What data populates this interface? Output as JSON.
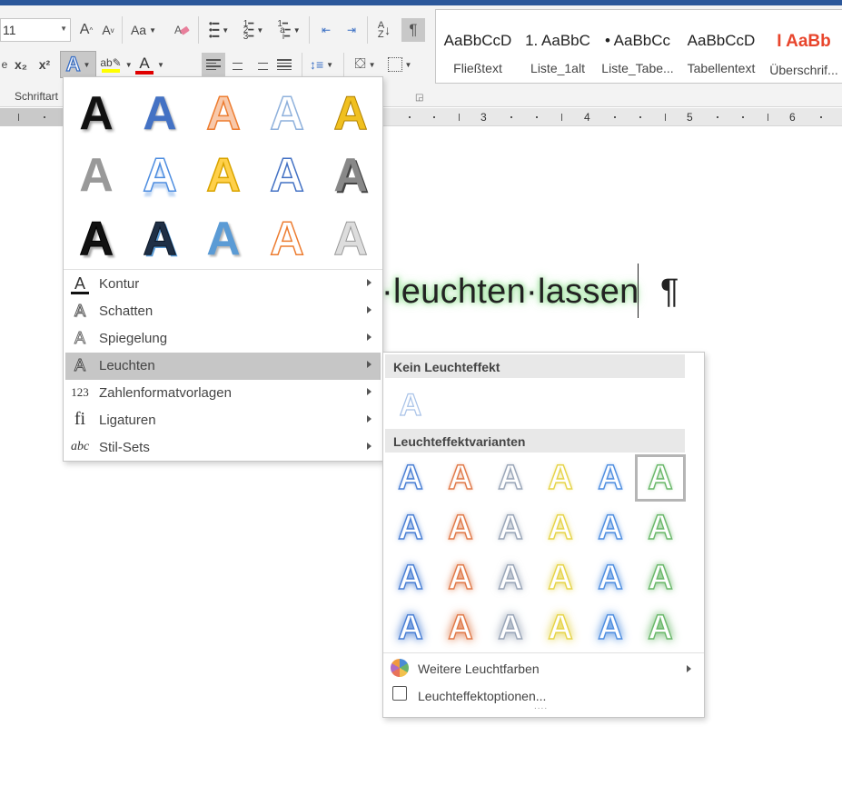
{
  "ribbon": {
    "font_size": "11",
    "grow_font": "A",
    "shrink_font": "A",
    "change_case": "Aa",
    "subscript": "x₂",
    "superscript": "x²",
    "font_color_letter": "A",
    "group_label": "Schriftart",
    "colors": {
      "highlight": "#ffff00",
      "font_color": "#e00000"
    }
  },
  "styles_gallery": [
    {
      "preview": "AaBbCcD",
      "name": "Fließtext"
    },
    {
      "preview": "1.  AaBbC",
      "name": "Liste_1alt"
    },
    {
      "preview": "•  AaBbCc",
      "name": "Liste_Tabe..."
    },
    {
      "preview": "AaBbCcD",
      "name": "Tabellentext"
    },
    {
      "preview": "I  AaBb",
      "name": "Überschrif..."
    }
  ],
  "ruler_marks": [
    "3",
    "4",
    "5",
    "6"
  ],
  "document": {
    "text": "·leuchten·lassen",
    "pilcrow": "¶"
  },
  "text_effects_menu": {
    "effect_glyph": "A",
    "items": [
      {
        "icon": "kontur-icon",
        "label": "Kontur",
        "glyph": "A"
      },
      {
        "icon": "schatten-icon",
        "label": "Schatten",
        "glyph": "A"
      },
      {
        "icon": "spiegelung-icon",
        "label": "Spiegelung",
        "glyph": "A"
      },
      {
        "icon": "leuchten-icon",
        "label": "Leuchten",
        "glyph": "A"
      },
      {
        "icon": "zahlenformat-icon",
        "label": "Zahlenformatvorlagen",
        "glyph": "123"
      },
      {
        "icon": "ligaturen-icon",
        "label": "Ligaturen",
        "glyph": "fi"
      },
      {
        "icon": "stilsets-icon",
        "label": "Stil-Sets",
        "glyph": "abc"
      }
    ]
  },
  "glow_submenu": {
    "no_glow_header": "Kein Leuchteffekt",
    "variants_header": "Leuchteffektvarianten",
    "glyph": "A",
    "variant_colors": [
      "#4a7fd4",
      "#e07a4a",
      "#9aa6b8",
      "#e6d44a",
      "#4f8ee0",
      "#6ab86a"
    ],
    "more_colors": "Weitere Leuchtfarben",
    "options": "Leuchteffektoptionen...",
    "grip": "....",
    "selected": "row 1, column 6"
  }
}
